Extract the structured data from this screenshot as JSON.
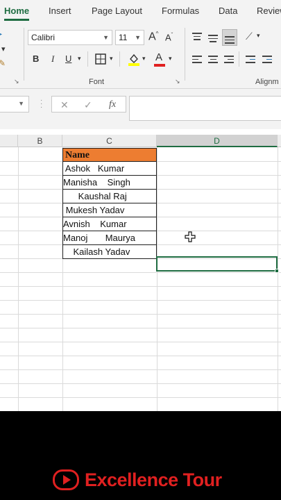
{
  "tabs": [
    {
      "label": "Home",
      "active": true
    },
    {
      "label": "Insert"
    },
    {
      "label": "Page Layout"
    },
    {
      "label": "Formulas"
    },
    {
      "label": "Data"
    },
    {
      "label": "Review"
    }
  ],
  "font_group": {
    "font_name": "Calibri",
    "font_size": "11",
    "grow_font": "A",
    "shrink_font": "A",
    "bold": "B",
    "italic": "I",
    "underline": "U",
    "font_color_glyph": "A",
    "label": "Font"
  },
  "alignment_group": {
    "label": "Alignm"
  },
  "formula_bar": {
    "fx_label": "fx",
    "cancel": "✕",
    "enter": "✓",
    "content": ""
  },
  "columns": [
    "B",
    "C",
    "D"
  ],
  "selected_column": "D",
  "table": {
    "header": "Name",
    "names": [
      " Ashok   Kumar",
      "Manisha    Singh",
      "      Kaushal Raj",
      " Mukesh Yadav",
      "Avnish    Kumar",
      "Manoj       Maurya",
      "    Kailash Yadav"
    ]
  },
  "colors": {
    "accent": "#1e6c41",
    "header_fill": "#ed7d31",
    "brand_red": "#e02020"
  },
  "brand": {
    "name": "Excellence Tour",
    "icon": "youtube-icon"
  }
}
